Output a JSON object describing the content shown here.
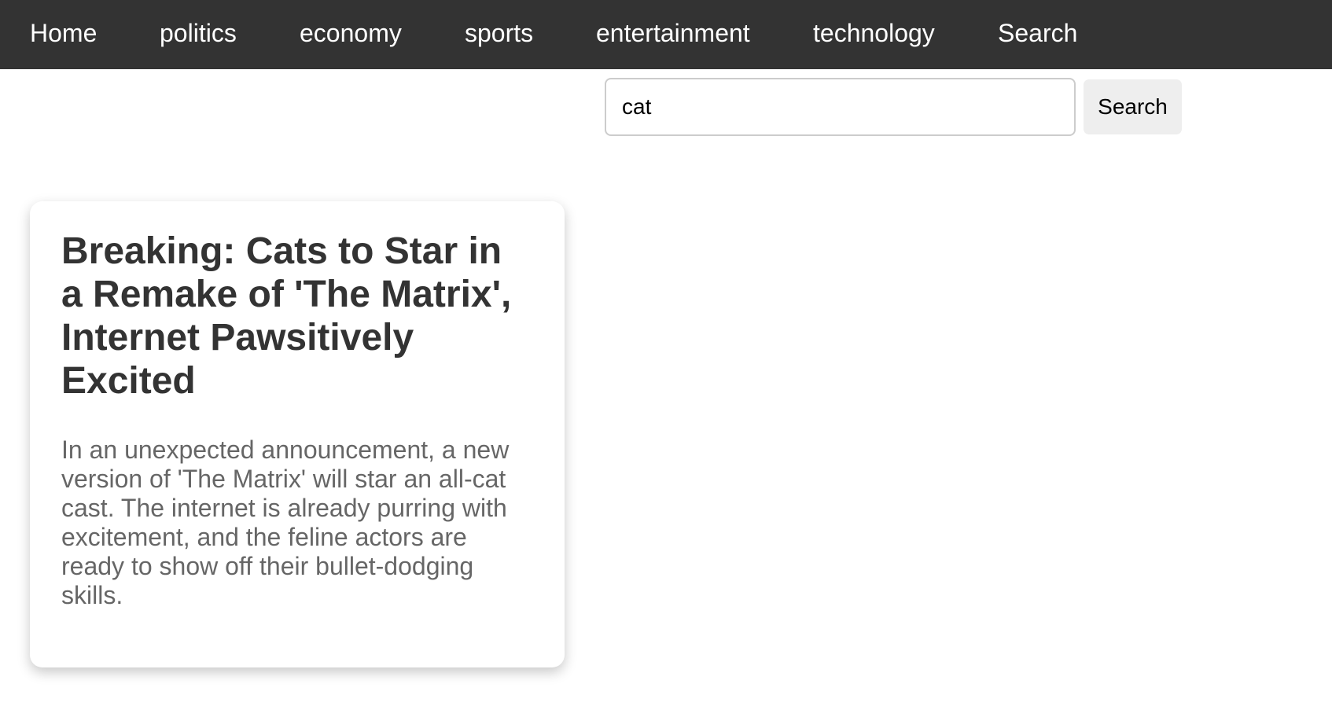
{
  "nav": {
    "items": [
      {
        "label": "Home"
      },
      {
        "label": "politics"
      },
      {
        "label": "economy"
      },
      {
        "label": "sports"
      },
      {
        "label": "entertainment"
      },
      {
        "label": "technology"
      },
      {
        "label": "Search"
      }
    ]
  },
  "search": {
    "value": "cat",
    "button_label": "Search"
  },
  "results": [
    {
      "title": "Breaking: Cats to Star in a Remake of 'The Matrix', Internet Pawsitively Excited",
      "summary": "In an unexpected announcement, a new version of 'The Matrix' will star an all-cat cast. The internet is already purring with excitement, and the feline actors are ready to show off their bullet-dodging skills."
    }
  ],
  "colors": {
    "nav_background": "#333333",
    "nav_text": "#ffffff",
    "title_text": "#333333",
    "summary_text": "#666666",
    "button_background": "#eeeeee"
  }
}
